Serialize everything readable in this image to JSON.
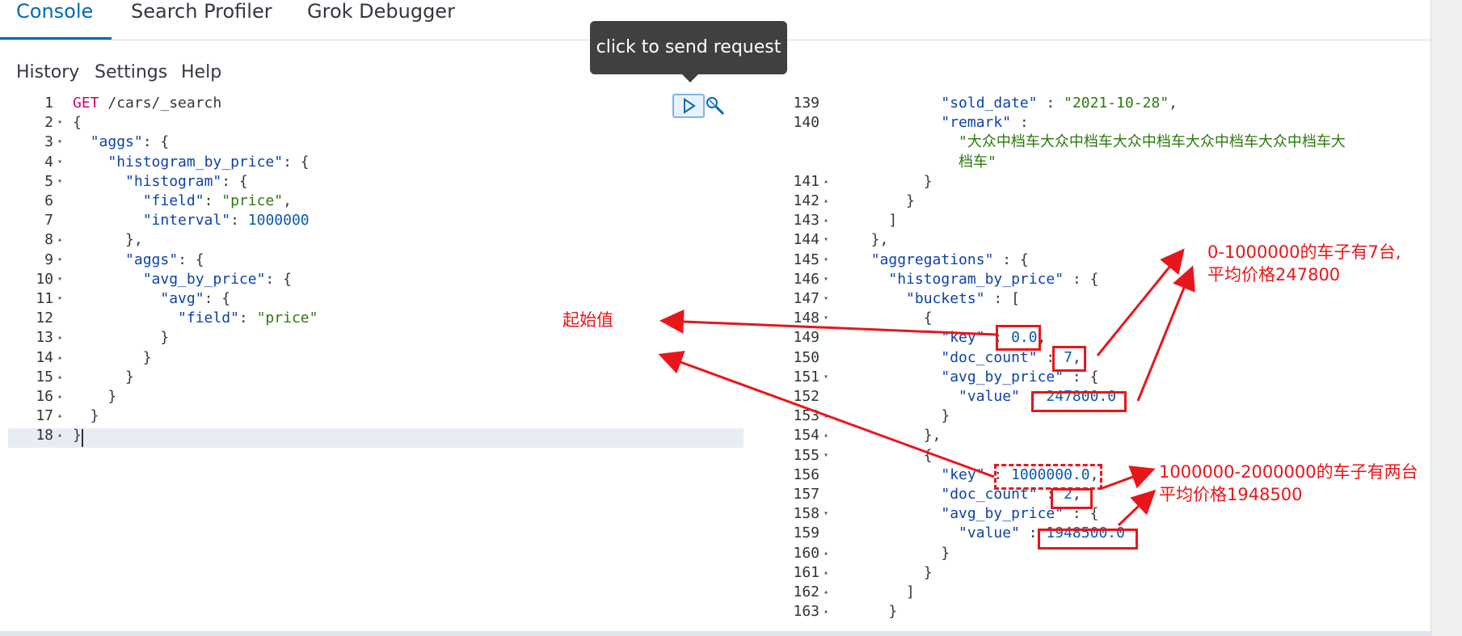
{
  "tabs": [
    "Console",
    "Search Profiler",
    "Grok Debugger"
  ],
  "menu": [
    "History",
    "Settings",
    "Help"
  ],
  "tooltip": "click to send request",
  "request": {
    "lines": [
      {
        "n": "1",
        "fold": "",
        "parts": [
          [
            "m",
            "GET"
          ],
          [
            "u",
            " /cars/_search"
          ]
        ]
      },
      {
        "n": "2",
        "fold": "▾",
        "parts": [
          [
            "p",
            "{"
          ]
        ]
      },
      {
        "n": "3",
        "fold": "▾",
        "parts": [
          [
            "p",
            "  "
          ],
          [
            "k",
            "\"aggs\""
          ],
          [
            "p",
            ": {"
          ]
        ]
      },
      {
        "n": "4",
        "fold": "▾",
        "parts": [
          [
            "p",
            "    "
          ],
          [
            "k",
            "\"histogram_by_price\""
          ],
          [
            "p",
            ": {"
          ]
        ]
      },
      {
        "n": "5",
        "fold": "▾",
        "parts": [
          [
            "p",
            "      "
          ],
          [
            "k",
            "\"histogram\""
          ],
          [
            "p",
            ": {"
          ]
        ]
      },
      {
        "n": "6",
        "fold": "",
        "parts": [
          [
            "p",
            "        "
          ],
          [
            "k",
            "\"field\""
          ],
          [
            "p",
            ": "
          ],
          [
            "s",
            "\"price\""
          ],
          [
            "p",
            ","
          ]
        ]
      },
      {
        "n": "7",
        "fold": "",
        "parts": [
          [
            "p",
            "        "
          ],
          [
            "k",
            "\"interval\""
          ],
          [
            "p",
            ": "
          ],
          [
            "n",
            "1000000"
          ]
        ]
      },
      {
        "n": "8",
        "fold": "▴",
        "parts": [
          [
            "p",
            "      },"
          ]
        ]
      },
      {
        "n": "9",
        "fold": "▾",
        "parts": [
          [
            "p",
            "      "
          ],
          [
            "k",
            "\"aggs\""
          ],
          [
            "p",
            ": {"
          ]
        ]
      },
      {
        "n": "10",
        "fold": "▾",
        "parts": [
          [
            "p",
            "        "
          ],
          [
            "k",
            "\"avg_by_price\""
          ],
          [
            "p",
            ": {"
          ]
        ]
      },
      {
        "n": "11",
        "fold": "▾",
        "parts": [
          [
            "p",
            "          "
          ],
          [
            "k",
            "\"avg\""
          ],
          [
            "p",
            ": {"
          ]
        ]
      },
      {
        "n": "12",
        "fold": "",
        "parts": [
          [
            "p",
            "            "
          ],
          [
            "k",
            "\"field\""
          ],
          [
            "p",
            ": "
          ],
          [
            "s",
            "\"price\""
          ]
        ]
      },
      {
        "n": "13",
        "fold": "▴",
        "parts": [
          [
            "p",
            "          }"
          ]
        ]
      },
      {
        "n": "14",
        "fold": "▴",
        "parts": [
          [
            "p",
            "        }"
          ]
        ]
      },
      {
        "n": "15",
        "fold": "▴",
        "parts": [
          [
            "p",
            "      }"
          ]
        ]
      },
      {
        "n": "16",
        "fold": "▴",
        "parts": [
          [
            "p",
            "    }"
          ]
        ]
      },
      {
        "n": "17",
        "fold": "▴",
        "parts": [
          [
            "p",
            "  }"
          ]
        ]
      },
      {
        "n": "18",
        "fold": "▴",
        "parts": [
          [
            "p",
            "}"
          ]
        ]
      }
    ]
  },
  "response": {
    "lines": [
      {
        "n": "139",
        "fold": "",
        "parts": [
          [
            "p",
            "          "
          ],
          [
            "k",
            "\"sold_date\""
          ],
          [
            "p",
            " : "
          ],
          [
            "s",
            "\"2021-10-28\""
          ],
          [
            "p",
            ","
          ]
        ]
      },
      {
        "n": "140",
        "fold": "",
        "parts": [
          [
            "p",
            "          "
          ],
          [
            "k",
            "\"remark\""
          ],
          [
            "p",
            " :"
          ]
        ]
      },
      {
        "n": "",
        "fold": "",
        "parts": [
          [
            "p",
            "            "
          ],
          [
            "s",
            "\"大众中档车大众中档车大众中档车大众中档车大众中档车大"
          ]
        ]
      },
      {
        "n": "",
        "fold": "",
        "parts": [
          [
            "p",
            "            "
          ],
          [
            "s",
            "档车\""
          ]
        ]
      },
      {
        "n": "141",
        "fold": "▴",
        "parts": [
          [
            "p",
            "        }"
          ]
        ]
      },
      {
        "n": "142",
        "fold": "▴",
        "parts": [
          [
            "p",
            "      }"
          ]
        ]
      },
      {
        "n": "143",
        "fold": "▴",
        "parts": [
          [
            "p",
            "    ]"
          ]
        ]
      },
      {
        "n": "144",
        "fold": "▾",
        "parts": [
          [
            "p",
            "  },"
          ]
        ]
      },
      {
        "n": "145",
        "fold": "▾",
        "parts": [
          [
            "p",
            "  "
          ],
          [
            "k",
            "\"aggregations\""
          ],
          [
            "p",
            " : {"
          ]
        ]
      },
      {
        "n": "146",
        "fold": "▾",
        "parts": [
          [
            "p",
            "    "
          ],
          [
            "k",
            "\"histogram_by_price\""
          ],
          [
            "p",
            " : {"
          ]
        ]
      },
      {
        "n": "147",
        "fold": "▾",
        "parts": [
          [
            "p",
            "      "
          ],
          [
            "k",
            "\"buckets\""
          ],
          [
            "p",
            " : ["
          ]
        ]
      },
      {
        "n": "148",
        "fold": "▾",
        "parts": [
          [
            "p",
            "        {"
          ]
        ]
      },
      {
        "n": "149",
        "fold": "",
        "parts": [
          [
            "p",
            "          "
          ],
          [
            "k",
            "\"key\""
          ],
          [
            "p",
            " : "
          ],
          [
            "n",
            "0.0"
          ],
          [
            "p",
            ","
          ]
        ]
      },
      {
        "n": "150",
        "fold": "",
        "parts": [
          [
            "p",
            "          "
          ],
          [
            "k",
            "\"doc_count\""
          ],
          [
            "p",
            " : "
          ],
          [
            "n",
            "7"
          ],
          [
            "p",
            ","
          ]
        ]
      },
      {
        "n": "151",
        "fold": "▾",
        "parts": [
          [
            "p",
            "          "
          ],
          [
            "k",
            "\"avg_by_price\""
          ],
          [
            "p",
            " : {"
          ]
        ]
      },
      {
        "n": "152",
        "fold": "",
        "parts": [
          [
            "p",
            "            "
          ],
          [
            "k",
            "\"value\""
          ],
          [
            "p",
            " : "
          ],
          [
            "n",
            "247800.0"
          ]
        ]
      },
      {
        "n": "153",
        "fold": "▴",
        "parts": [
          [
            "p",
            "          }"
          ]
        ]
      },
      {
        "n": "154",
        "fold": "▴",
        "parts": [
          [
            "p",
            "        },"
          ]
        ]
      },
      {
        "n": "155",
        "fold": "▾",
        "parts": [
          [
            "p",
            "        {"
          ]
        ]
      },
      {
        "n": "156",
        "fold": "",
        "parts": [
          [
            "p",
            "          "
          ],
          [
            "k",
            "\"key\""
          ],
          [
            "p",
            " : "
          ],
          [
            "n",
            "1000000.0"
          ],
          [
            "p",
            ","
          ]
        ]
      },
      {
        "n": "157",
        "fold": "",
        "parts": [
          [
            "p",
            "          "
          ],
          [
            "k",
            "\"doc_count\""
          ],
          [
            "p",
            " : "
          ],
          [
            "n",
            "2"
          ],
          [
            "p",
            ","
          ]
        ]
      },
      {
        "n": "158",
        "fold": "▾",
        "parts": [
          [
            "p",
            "          "
          ],
          [
            "k",
            "\"avg_by_price\""
          ],
          [
            "p",
            " : {"
          ]
        ]
      },
      {
        "n": "159",
        "fold": "",
        "parts": [
          [
            "p",
            "            "
          ],
          [
            "k",
            "\"value\""
          ],
          [
            "p",
            " : "
          ],
          [
            "n",
            "1948500.0"
          ]
        ]
      },
      {
        "n": "160",
        "fold": "▴",
        "parts": [
          [
            "p",
            "          }"
          ]
        ]
      },
      {
        "n": "161",
        "fold": "▴",
        "parts": [
          [
            "p",
            "        }"
          ]
        ]
      },
      {
        "n": "162",
        "fold": "▴",
        "parts": [
          [
            "p",
            "      ]"
          ]
        ]
      },
      {
        "n": "163",
        "fold": "▴",
        "parts": [
          [
            "p",
            "    }"
          ]
        ]
      }
    ]
  },
  "annotations": {
    "start_value": "起始值",
    "bucket1_line1": "0-1000000的车子有7台,",
    "bucket1_line2": "平均价格247800",
    "bucket2_line1": "1000000-2000000的车子有两台",
    "bucket2_line2": "平均价格1948500"
  },
  "icons": {
    "play": "play-icon",
    "wrench": "wrench-icon"
  },
  "colors": {
    "accent": "#006bb4",
    "annotation": "#e8161b"
  }
}
